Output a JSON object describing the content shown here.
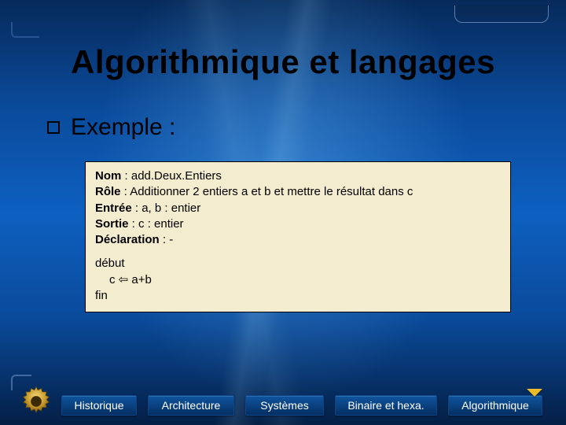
{
  "title": "Algorithmique et langages",
  "section": {
    "heading": "Exemple :"
  },
  "algo": {
    "labels": {
      "nom": "Nom",
      "role": "Rôle",
      "entree": "Entrée",
      "sortie": "Sortie",
      "declaration": "Déclaration",
      "debut": "début",
      "fin": "fin"
    },
    "nom": "add.Deux.Entiers",
    "role": "Additionner 2 entiers a et b et mettre le résultat dans c",
    "entree": "a, b : entier",
    "sortie": "c : entier",
    "declaration": "-",
    "body_line": "c ⇦ a+b"
  },
  "nav": {
    "items": [
      "Historique",
      "Architecture",
      "Systèmes",
      "Binaire et hexa.",
      "Algorithmique"
    ]
  }
}
